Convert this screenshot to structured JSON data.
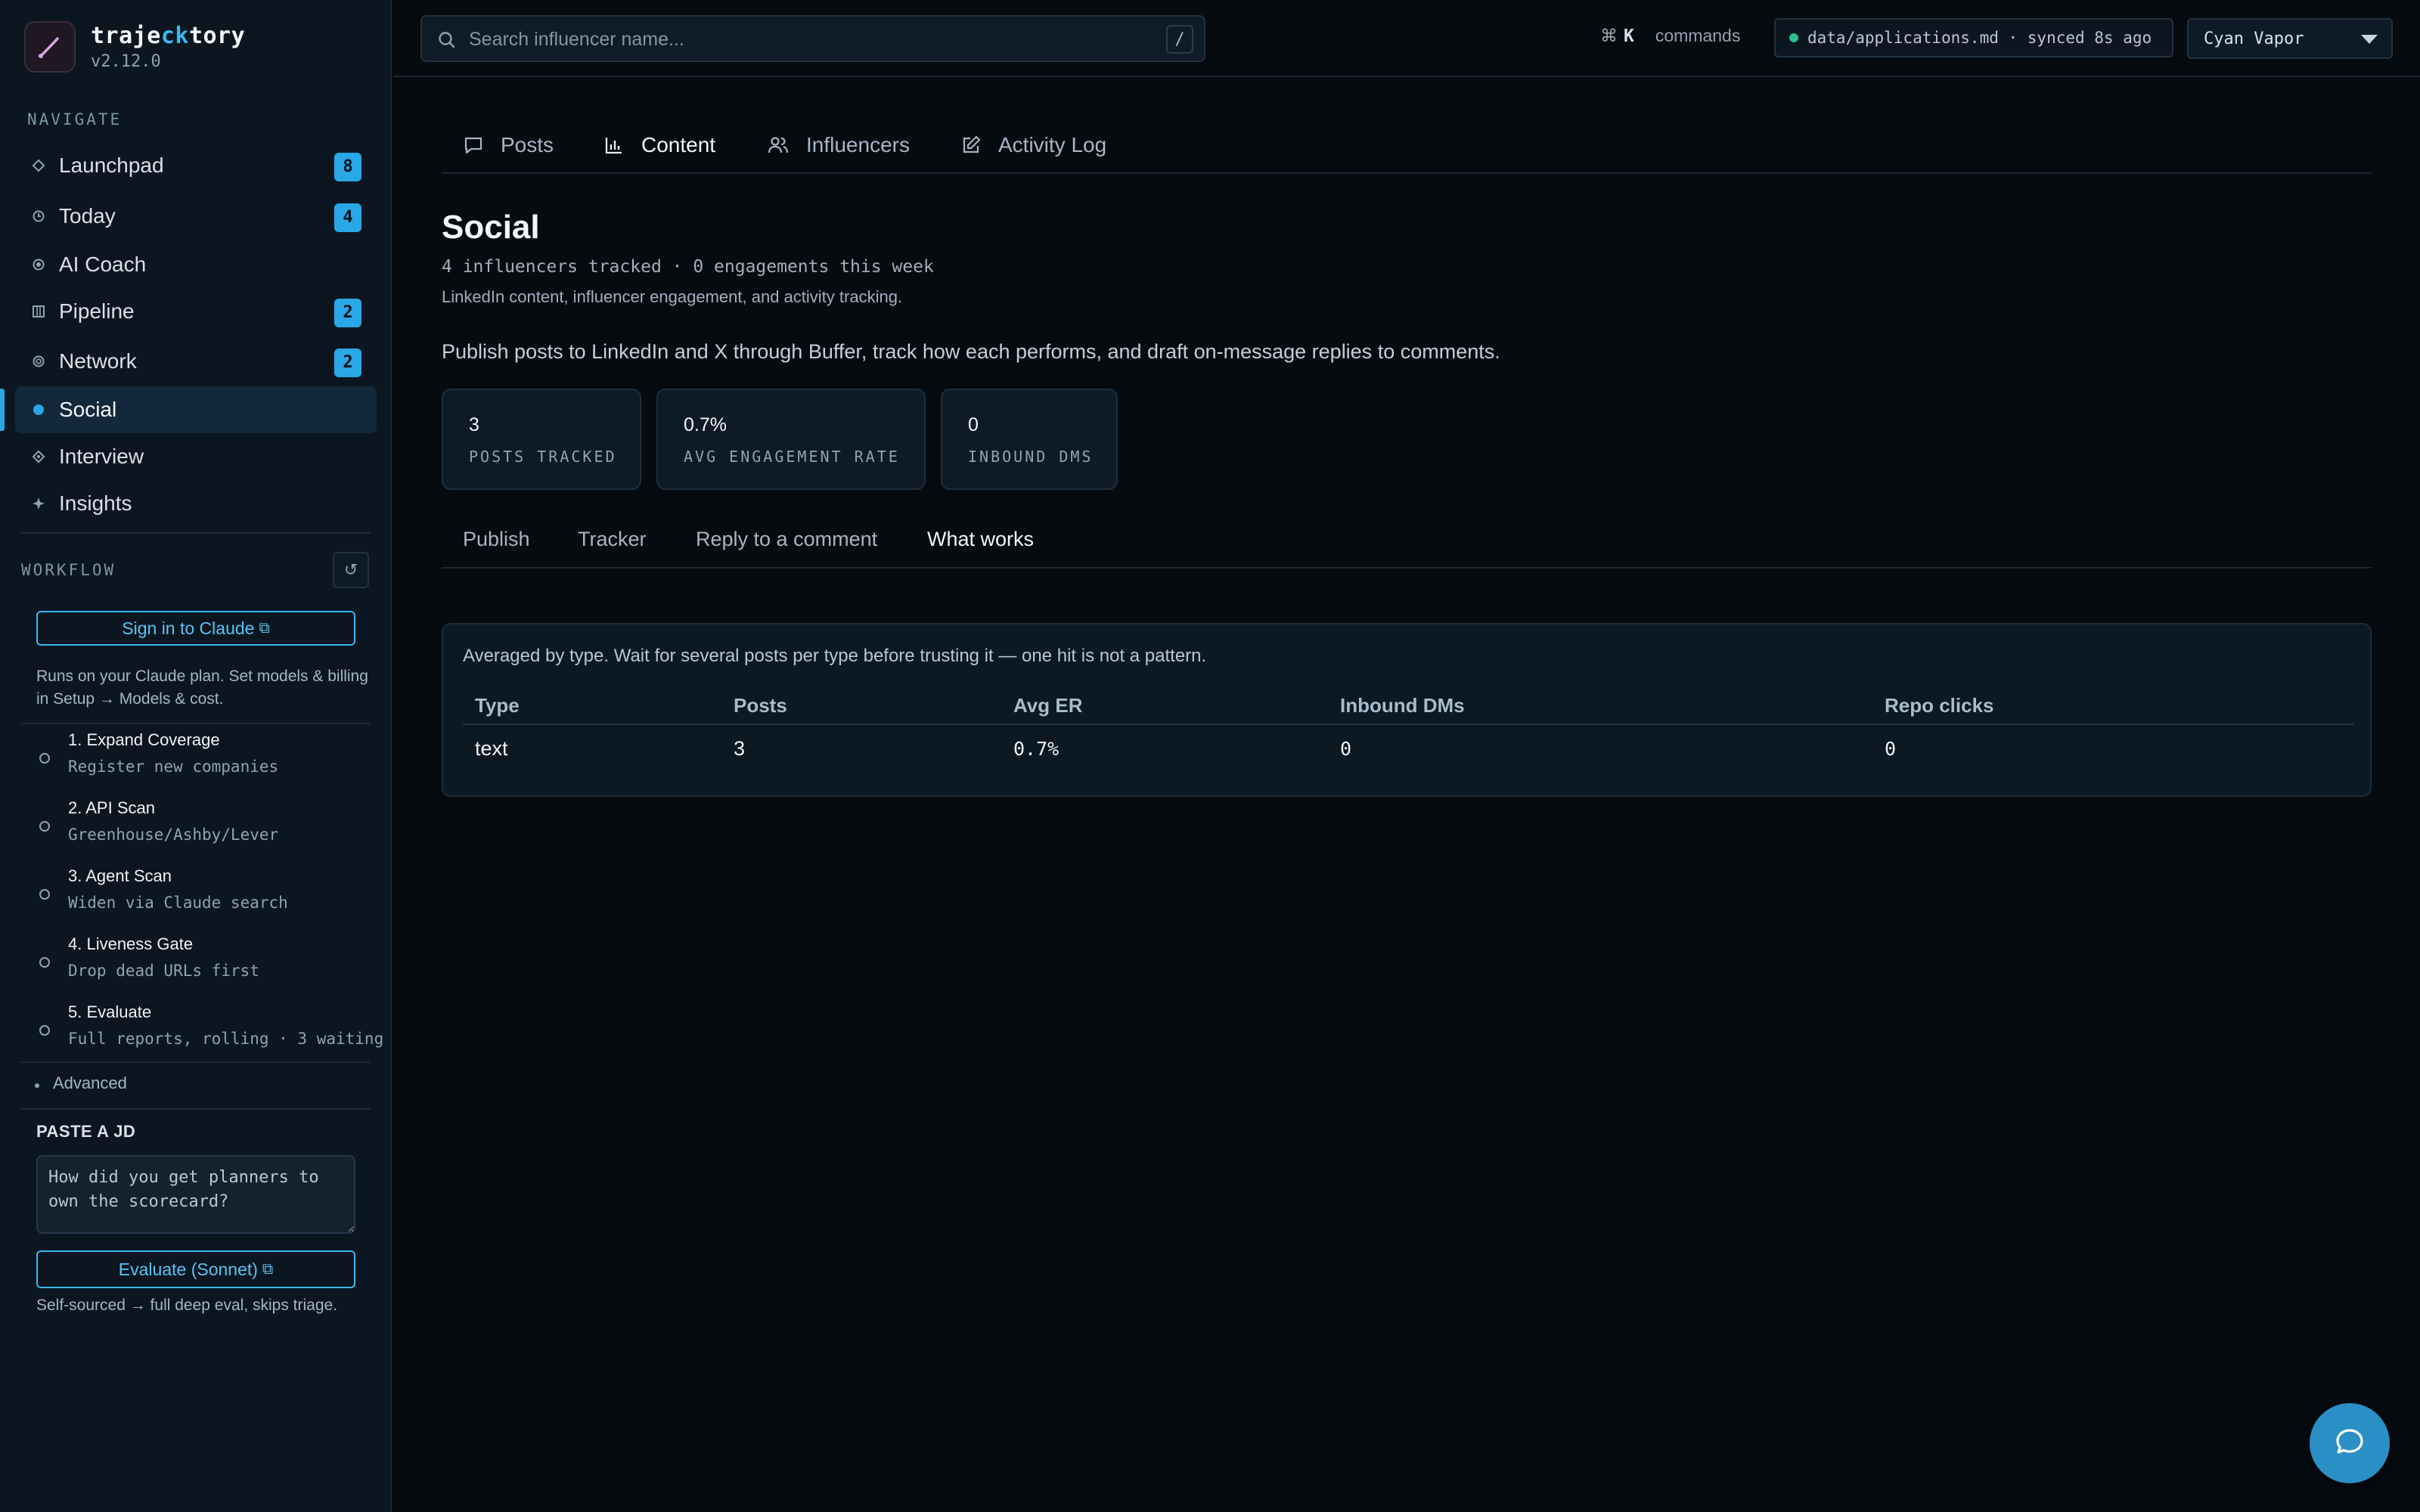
{
  "brand": {
    "name_prefix": "traje",
    "name_highlight": "ck",
    "name_suffix": "tory",
    "version": "v2.12.0"
  },
  "sidebar": {
    "navigate_label": "NAVIGATE",
    "items": [
      {
        "label": "Launchpad",
        "icon": "diamond-outline-icon",
        "badge": "8"
      },
      {
        "label": "Today",
        "icon": "clock-icon",
        "badge": "4"
      },
      {
        "label": "AI Coach",
        "icon": "target-icon",
        "badge": ""
      },
      {
        "label": "Pipeline",
        "icon": "columns-icon",
        "badge": "2"
      },
      {
        "label": "Network",
        "icon": "ring-icon",
        "badge": "2"
      },
      {
        "label": "Social",
        "icon": "dot-filled-icon",
        "badge": ""
      },
      {
        "label": "Interview",
        "icon": "diamond-dot-icon",
        "badge": ""
      },
      {
        "label": "Insights",
        "icon": "sparkle-icon",
        "badge": ""
      }
    ],
    "active_item": "Social",
    "workflow_label": "WORKFLOW",
    "sign_in_label": "Sign in to Claude",
    "plan_note": "Runs on your Claude plan. Set models & billing in Setup → Models & cost.",
    "steps": [
      {
        "title": "1. Expand Coverage",
        "subtitle": "Register new companies"
      },
      {
        "title": "2. API Scan",
        "subtitle": "Greenhouse/Ashby/Lever"
      },
      {
        "title": "3. Agent Scan",
        "subtitle": "Widen via Claude search"
      },
      {
        "title": "4. Liveness Gate",
        "subtitle": "Drop dead URLs first"
      },
      {
        "title": "5. Evaluate",
        "subtitle": "Full reports, rolling · 3 waiting"
      }
    ],
    "advanced_label": "Advanced",
    "jd_label": "PASTE A JD",
    "jd_value": "How did you get planners to own the scorecard?",
    "evaluate_label": "Evaluate (Sonnet)",
    "evaluate_note": "Self-sourced → full deep eval, skips triage."
  },
  "topbar": {
    "search_placeholder": "Search influencer name...",
    "search_shortcut": "/",
    "cmd_symbol": "⌘",
    "cmd_key": "K",
    "cmd_label": "commands",
    "sync_text": "data/applications.md · synced 8s ago",
    "theme": "Cyan Vapor"
  },
  "main": {
    "tabs": [
      {
        "label": "Posts",
        "icon": "chat-bubble-icon"
      },
      {
        "label": "Content",
        "icon": "bar-chart-icon"
      },
      {
        "label": "Influencers",
        "icon": "users-icon"
      },
      {
        "label": "Activity Log",
        "icon": "edit-icon"
      }
    ],
    "active_tab": "Content",
    "title": "Social",
    "meta": "4 influencers tracked · 0 engagements this week",
    "subtitle": "LinkedIn content, influencer engagement, and activity tracking.",
    "description": "Publish posts to LinkedIn and X through Buffer, track how each performs, and draft on-message replies to comments.",
    "stats": [
      {
        "value": "3",
        "label": "POSTS TRACKED"
      },
      {
        "value": "0.7%",
        "label": "AVG ENGAGEMENT RATE"
      },
      {
        "value": "0",
        "label": "INBOUND DMS"
      }
    ],
    "sub_tabs": [
      "Publish",
      "Tracker",
      "Reply to a comment",
      "What works"
    ],
    "active_sub_tab": "What works",
    "panel_note": "Averaged by type. Wait for several posts per type before trusting it — one hit is not a pattern.",
    "table": {
      "headers": [
        "Type",
        "Posts",
        "Avg ER",
        "Inbound DMs",
        "Repo clicks"
      ],
      "rows": [
        [
          "text",
          "3",
          "0.7%",
          "0",
          "0"
        ]
      ]
    }
  },
  "colors": {
    "accent": "#2aa7e6",
    "background": "#060b10",
    "sidebar": "#0b1620",
    "sync_ok": "#27c28a"
  }
}
